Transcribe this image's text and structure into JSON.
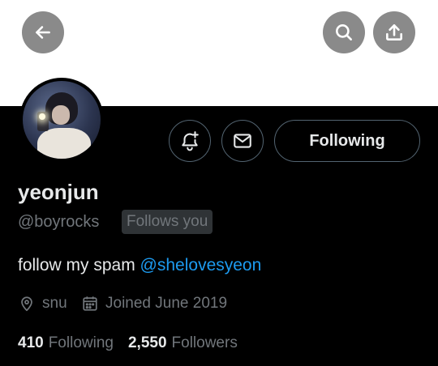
{
  "colors": {
    "background": "#000000",
    "banner": "#ffffff",
    "overlay_button": "#8a8a8a",
    "text_primary": "#e7e9ea",
    "text_secondary": "#71767b",
    "mention": "#1d9bf0",
    "border": "#536471"
  },
  "icons": {
    "back": "arrow-left-icon",
    "search": "search-icon",
    "share": "share-icon",
    "notify": "bell-plus-icon",
    "message": "envelope-icon",
    "location": "location-pin-icon",
    "calendar": "calendar-icon"
  },
  "profile": {
    "display_name": "yeonjun",
    "handle": "@boyrocks",
    "follows_you_badge": "Follows you",
    "bio_text": "follow my spam ",
    "bio_mention": "@shelovesyeon",
    "location": "snu",
    "joined": "Joined June 2019"
  },
  "actions": {
    "following_label": "Following"
  },
  "stats": {
    "following_count": "410",
    "following_label": "Following",
    "followers_count": "2,550",
    "followers_label": "Followers"
  }
}
